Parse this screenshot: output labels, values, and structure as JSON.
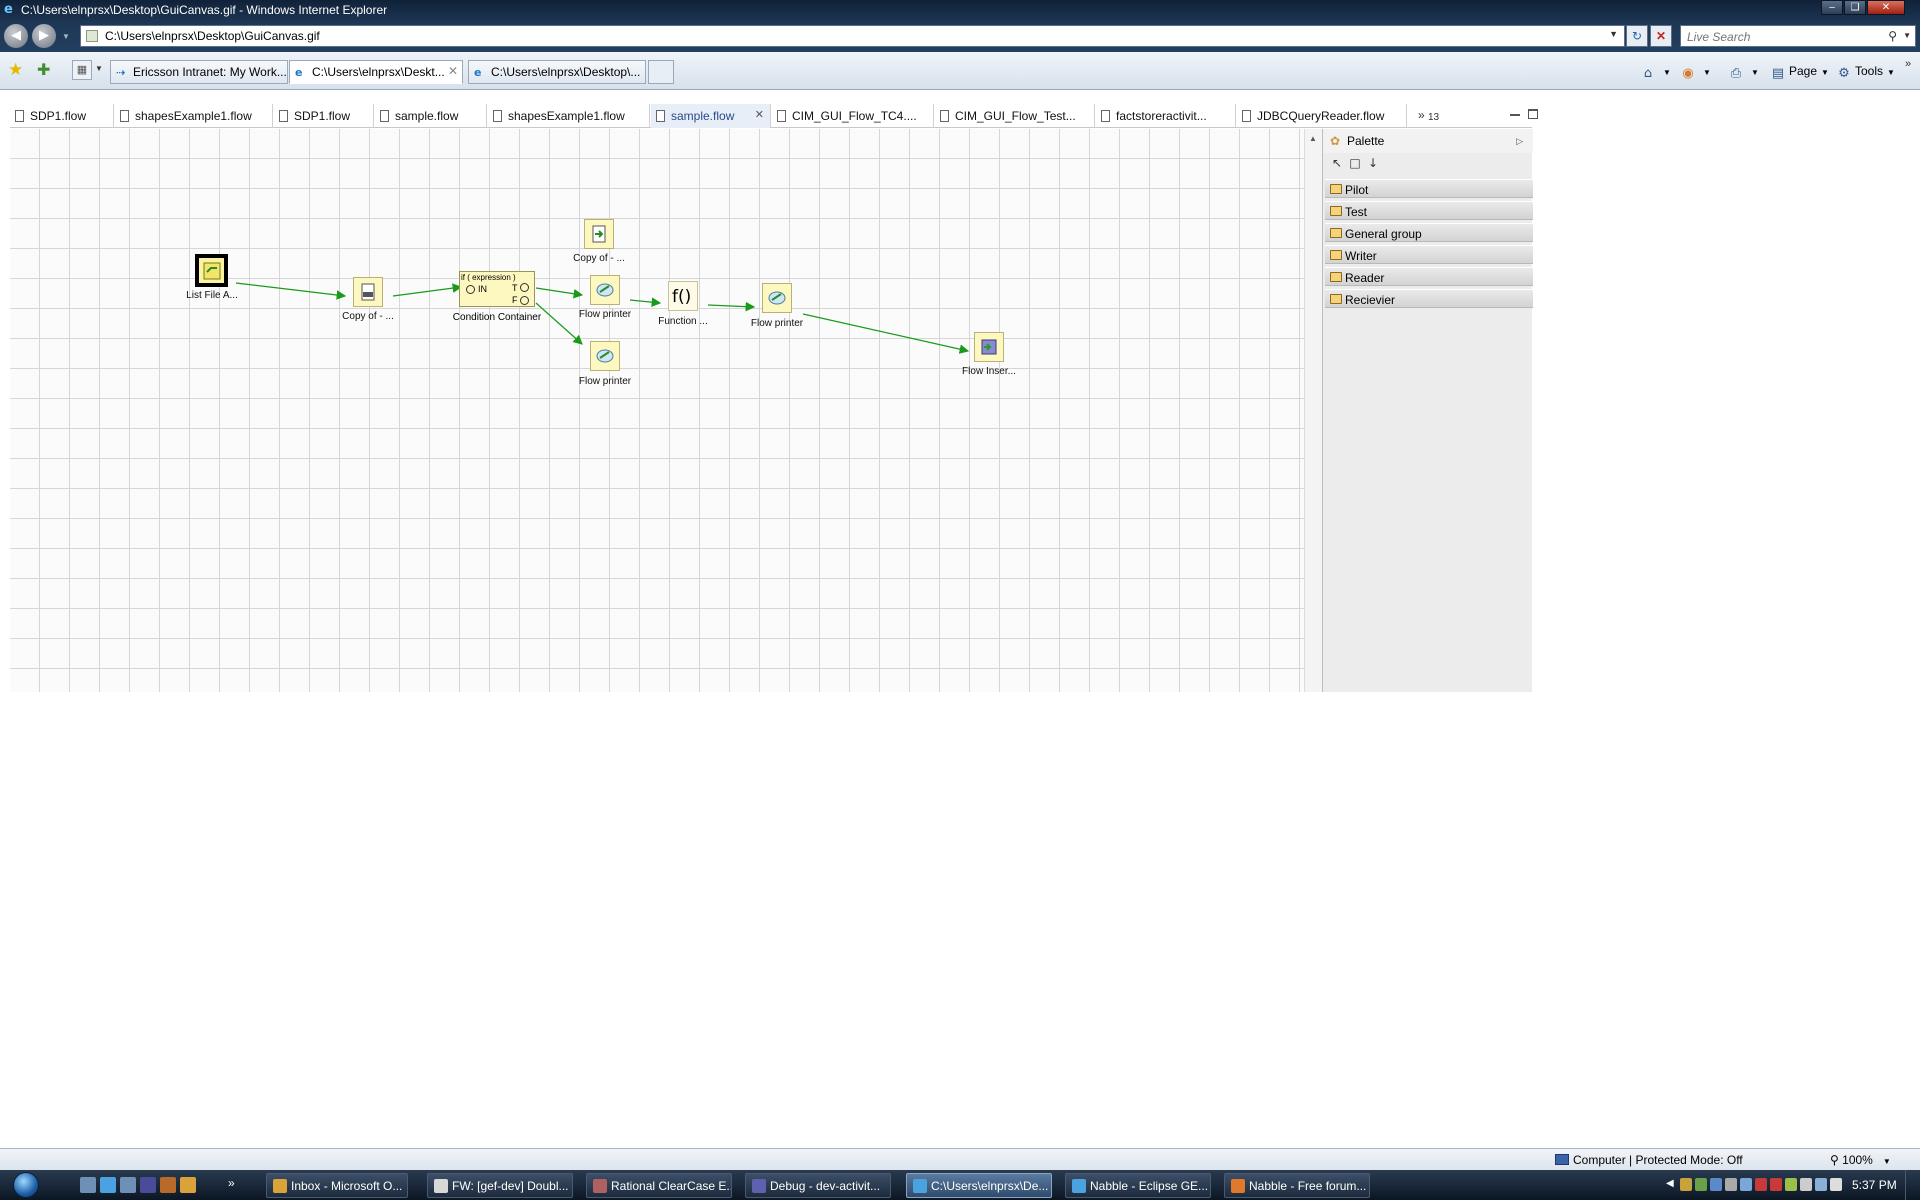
{
  "window": {
    "title": "C:\\Users\\elnprsx\\Desktop\\GuiCanvas.gif - Windows Internet Explorer"
  },
  "address_bar": {
    "url": "C:\\Users\\elnprsx\\Desktop\\GuiCanvas.gif",
    "search_placeholder": "Live Search"
  },
  "ie_tabs": [
    {
      "label": "Ericsson Intranet: My Work...",
      "icon": "arrow-icon"
    },
    {
      "label": "C:\\Users\\elnprsx\\Deskt...",
      "icon": "ie-icon",
      "active": true
    },
    {
      "label": "C:\\Users\\elnprsx\\Desktop\\...",
      "icon": "ie-icon"
    }
  ],
  "commands": {
    "page": "Page",
    "tools": "Tools"
  },
  "editor_tabs": [
    {
      "label": "SDP1.flow"
    },
    {
      "label": "shapesExample1.flow"
    },
    {
      "label": "SDP1.flow"
    },
    {
      "label": "sample.flow"
    },
    {
      "label": "shapesExample1.flow"
    },
    {
      "label": "sample.flow",
      "active": true
    },
    {
      "label": "CIM_GUI_Flow_TC4...."
    },
    {
      "label": "CIM_GUI_Flow_Test..."
    },
    {
      "label": "factstoreractivit..."
    },
    {
      "label": "JDBCQueryReader.flow"
    }
  ],
  "editor_more_count": "13",
  "flow_nodes": {
    "list_file": "List File A...",
    "copy_csv": "Copy of - ...",
    "condition": "Condition Container",
    "condition_expr": "if (  expression  )",
    "condition_in": "IN",
    "condition_true": "T",
    "condition_false": "F",
    "copy_top": "Copy of - ...",
    "flow_printer_1": "Flow printer",
    "flow_printer_2": "Flow printer",
    "function": "Function ...",
    "function_glyph": "f()",
    "flow_printer_3": "Flow printer",
    "flow_inserter": "Flow Inser..."
  },
  "palette": {
    "title": "Palette",
    "drawers": [
      "Pilot",
      "Test",
      "General group",
      "Writer",
      "Reader",
      "Recievier"
    ]
  },
  "status_bar": {
    "zone": "Computer | Protected Mode: Off",
    "zoom": "100%"
  },
  "taskbar": {
    "tasks": [
      {
        "label": "Inbox - Microsoft O...",
        "color": "#d9a33a"
      },
      {
        "label": "FW: [gef-dev] Doubl...",
        "color": "#d8d8d8"
      },
      {
        "label": "Rational ClearCase E...",
        "color": "#b06060"
      },
      {
        "label": "Debug - dev-activit...",
        "color": "#6060b0"
      },
      {
        "label": "C:\\Users\\elnprsx\\De...",
        "color": "#4aa3e0",
        "active": true
      },
      {
        "label": "Nabble - Eclipse GE...",
        "color": "#4aa3e0"
      },
      {
        "label": "Nabble - Free forum...",
        "color": "#e07a2a"
      }
    ],
    "clock": "5:37 PM"
  }
}
